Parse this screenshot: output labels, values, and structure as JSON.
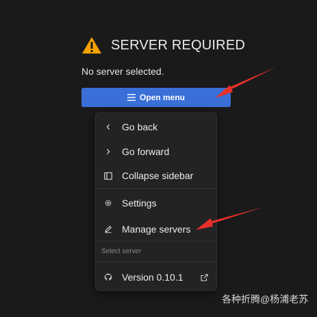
{
  "header": {
    "icon": "warning-icon",
    "title": "SERVER REQUIRED"
  },
  "subtitle": "No server selected.",
  "open_menu": {
    "icon": "menu-lines-icon",
    "label": "Open menu"
  },
  "menu": {
    "items": [
      {
        "icon": "chevron-left-icon",
        "label": "Go back"
      },
      {
        "icon": "chevron-right-icon",
        "label": "Go forward"
      },
      {
        "icon": "sidebar-icon",
        "label": "Collapse sidebar"
      },
      {
        "icon": "gear-icon",
        "label": "Settings"
      },
      {
        "icon": "pencil-icon",
        "label": "Manage servers"
      }
    ],
    "section_label": "Select server",
    "version": {
      "icon": "github-icon",
      "label": "Version 0.10.1",
      "trailing_icon": "external-link-icon"
    }
  },
  "colors": {
    "accent": "#3a6fd8",
    "warning": "#f4a100",
    "annotation_arrow": "#e8302a",
    "background": "#1a1a1a"
  },
  "watermark": "各种折腾@杨浦老苏"
}
